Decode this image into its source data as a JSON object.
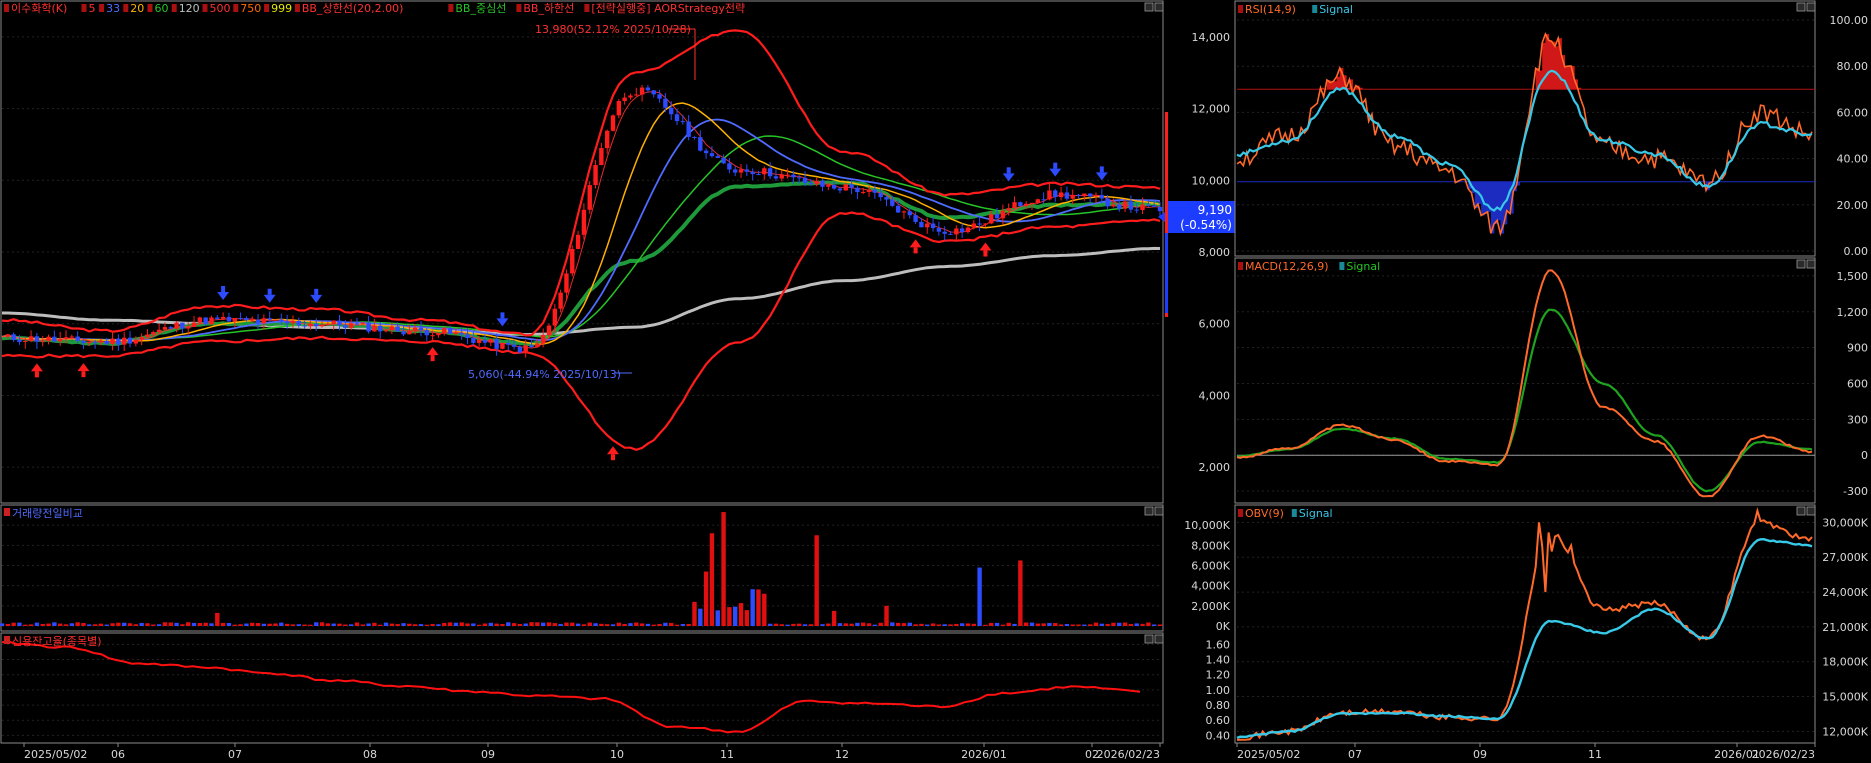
{
  "price_pane": {
    "legend": [
      "이수화학(K)",
      "5",
      "33",
      "20",
      "60",
      "120",
      "500",
      "750",
      "999",
      "BB_상한선(20,2.00)",
      "BB_중심선",
      "BB_하한선",
      "[전략실행중] AORStrategy전략"
    ],
    "legend_colors": [
      "#ff3030",
      "#ff3030",
      "#4f6bff",
      "#ffb000",
      "#27c427",
      "#c0c0c0",
      "#ff3030",
      "#ff6a00",
      "#e6e600",
      "#ff3030",
      "#27c427",
      "#ff3030",
      "#ff3030"
    ],
    "max_annotation": "13,980(52.12% 2025/10/28)",
    "min_annotation": "5,060(-44.94% 2025/10/13)",
    "current_price": "9,190",
    "current_change": "(-0.54%)",
    "y_ticks": [
      "14,000",
      "12,000",
      "10,000",
      "8,000",
      "6,000",
      "4,000",
      "2,000"
    ],
    "y_tick_values": [
      14000,
      12000,
      10000,
      8000,
      6000,
      4000,
      2000
    ],
    "y_range": [
      1000,
      15000
    ]
  },
  "volume_pane": {
    "legend": "거래량전일비교",
    "y_ticks": [
      "10,000K",
      "8,000K",
      "6,000K",
      "4,000K",
      "2,000K",
      "0K"
    ],
    "y_tick_values": [
      10000,
      8000,
      6000,
      4000,
      2000,
      0
    ],
    "y_range": [
      0,
      12000
    ]
  },
  "credit_pane": {
    "legend": "신용잔고율(종목별)",
    "y_ticks": [
      "1.60",
      "1.40",
      "1.20",
      "1.00",
      "0.80",
      "0.60",
      "0.40"
    ],
    "y_tick_values": [
      1.6,
      1.4,
      1.2,
      1.0,
      0.8,
      0.6,
      0.4
    ],
    "y_range": [
      0.3,
      1.75
    ]
  },
  "left_x_labels": [
    "2025/05/02",
    "06",
    "07",
    "08",
    "09",
    "10",
    "11",
    "12",
    "2026/01",
    "02",
    "2026/02/23"
  ],
  "rsi_pane": {
    "legend": [
      "RSI(14,9)",
      "Signal"
    ],
    "legend_colors": [
      "#ff6a2a",
      "#38c8e8"
    ],
    "y_ticks": [
      "100.00",
      "80.00",
      "60.00",
      "40.00",
      "20.00",
      "0.00"
    ],
    "y_tick_values": [
      100,
      80,
      60,
      40,
      20,
      0
    ],
    "y_range": [
      0,
      100
    ],
    "upper_line": 70,
    "lower_line": 30
  },
  "macd_pane": {
    "legend": [
      "MACD(12,26,9)",
      "Signal"
    ],
    "legend_colors": [
      "#ff6a2a",
      "#27c427"
    ],
    "y_ticks": [
      "1,500",
      "1,200",
      "900",
      "600",
      "300",
      "0",
      "-300"
    ],
    "y_tick_values": [
      1500,
      1200,
      900,
      600,
      300,
      0,
      -300
    ],
    "y_range": [
      -400,
      1650
    ]
  },
  "obv_pane": {
    "legend": [
      "OBV(9)",
      "Signal"
    ],
    "legend_colors": [
      "#ff6a2a",
      "#38c8e8"
    ],
    "y_ticks": [
      "30,000K",
      "27,000K",
      "24,000K",
      "21,000K",
      "18,000K",
      "15,000K",
      "12,000K"
    ],
    "y_tick_values": [
      30000,
      27000,
      24000,
      21000,
      18000,
      15000,
      12000
    ],
    "y_range": [
      11000,
      31500
    ]
  },
  "right_x_labels": [
    "2025/05/02",
    "07",
    "09",
    "11",
    "2026/01",
    "2026/02/23"
  ],
  "chart_data": [
    {
      "type": "line",
      "title": "이수화학(K)",
      "x": [
        "2025/05",
        "2025/06",
        "2025/07",
        "2025/08",
        "2025/09",
        "2025/10",
        "2025/10/28",
        "2025/11",
        "2025/12",
        "2026/01",
        "2026/02",
        "2026/02/23"
      ],
      "series": [
        {
          "name": "이수화학(K)",
          "values": [
            5600,
            5500,
            6100,
            6000,
            5800,
            5300,
            12500,
            10300,
            9800,
            8600,
            9600,
            9190
          ]
        },
        {
          "name": "BB_상한선",
          "values": [
            6100,
            5800,
            6500,
            6400,
            6100,
            5700,
            13000,
            14200,
            10800,
            9600,
            9900,
            9800
          ]
        },
        {
          "name": "BB_하한선",
          "values": [
            5100,
            5100,
            5500,
            5600,
            5500,
            5200,
            2500,
            5500,
            9100,
            8300,
            8700,
            8900
          ]
        },
        {
          "name": "120",
          "values": [
            6300,
            6100,
            6000,
            5900,
            5850,
            5700,
            5900,
            6700,
            7200,
            7600,
            7900,
            8100
          ]
        }
      ]
    },
    {
      "type": "line",
      "title": "RSI(14,9)",
      "series": [
        {
          "name": "RSI(14,9)",
          "values": [
            40,
            50,
            75,
            45,
            35,
            10,
            92,
            45,
            40,
            30,
            60,
            50
          ]
        },
        {
          "name": "Signal",
          "values": [
            42,
            48,
            70,
            50,
            38,
            18,
            78,
            48,
            42,
            28,
            55,
            50
          ]
        }
      ]
    },
    {
      "type": "line",
      "title": "MACD(12,26,9)",
      "series": [
        {
          "name": "MACD(12,26,9)",
          "values": [
            -20,
            60,
            250,
            130,
            -50,
            -80,
            1550,
            400,
            120,
            -350,
            160,
            30
          ]
        },
        {
          "name": "Signal",
          "values": [
            -10,
            50,
            220,
            140,
            -30,
            -60,
            1220,
            600,
            170,
            -300,
            110,
            50
          ]
        }
      ]
    },
    {
      "type": "line",
      "title": "OBV(9)",
      "series": [
        {
          "name": "OBV(9)",
          "values": [
            11500,
            12000,
            13600,
            13700,
            13200,
            13100,
            29000,
            22500,
            23000,
            20000,
            30000,
            28500
          ]
        },
        {
          "name": "Signal",
          "values": [
            11500,
            12000,
            13500,
            13600,
            13300,
            13100,
            21500,
            20500,
            22500,
            20000,
            28500,
            28000
          ]
        }
      ]
    }
  ]
}
